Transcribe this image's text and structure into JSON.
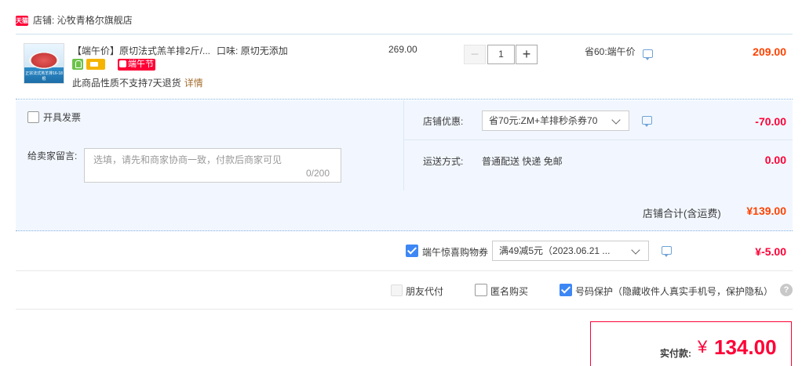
{
  "shop": {
    "badge": "天猫",
    "label": "店铺:",
    "name": "沁牧青格尔旗舰店"
  },
  "item": {
    "thumb_caption": "正宗法式羔羊排16-18根",
    "title": "【端午价】原切法式羔羊排2斤/...",
    "flavor_label": "口味:",
    "flavor_value": "原切无添加",
    "festival_badge": "端午节",
    "notice": "此商品性质不支持7天退货",
    "notice_link": "详情",
    "unit_price": "269.00",
    "quantity": "1",
    "minus_symbol": "−",
    "plus_symbol": "+",
    "promo_note": "省60:端午价",
    "total": "209.00"
  },
  "invoice": {
    "label": "开具发票",
    "checked": false
  },
  "message": {
    "label": "给卖家留言:",
    "placeholder": "选填，请先和商家协商一致，付款后商家可见",
    "count": "0/200"
  },
  "shop_discount": {
    "label": "店铺优惠:",
    "selected": "省70元:ZM+羊排秒杀券70",
    "amount": "-70.00"
  },
  "shipping": {
    "label": "运送方式:",
    "value": "普通配送 快递 免邮",
    "amount": "0.00"
  },
  "shop_total": {
    "label": "店铺合计(含运费)",
    "amount": "¥139.00"
  },
  "coupon": {
    "label": "端午惊喜购物券",
    "checked": true,
    "selected": "满49减5元（2023.06.21 ...",
    "amount": "¥-5.00"
  },
  "options": {
    "friend_pay": "朋友代付",
    "anonymous": "匿名购买",
    "privacy": "号码保护（隐藏收件人真实手机号，保护隐私）",
    "help_symbol": "?"
  },
  "payment": {
    "label": "实付款:",
    "currency": "¥",
    "amount": "134.00"
  },
  "colors": {
    "accent_red": "#ff0036",
    "price_orange": "#ff4200",
    "panel_bg": "#f2f7ff",
    "check_blue": "#3d87f5"
  }
}
